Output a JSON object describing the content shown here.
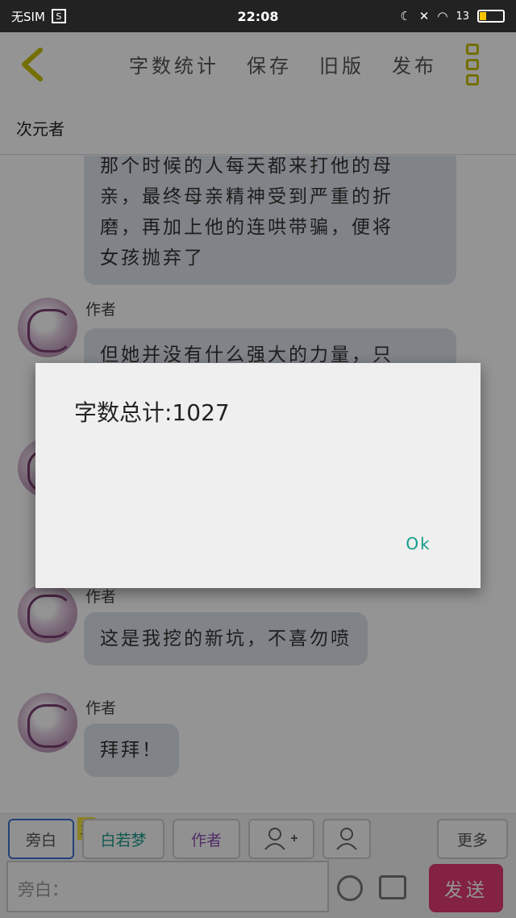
{
  "status_bar": {
    "sim_text": "无SIM",
    "time": "22:08",
    "battery": "13",
    "battery_color": "#f5c400"
  },
  "header": {
    "back_icon": "chevron-left-icon",
    "menu": [
      "字数统计",
      "保存",
      "旧版",
      "发布"
    ],
    "more_icon": "vertical-dots-icon",
    "accent_color": "#c8c000"
  },
  "chat_title": "次元者",
  "messages": [
    {
      "sender": "",
      "text_lines": [
        "那个时候的人每天都来打他的母",
        "亲，最终母亲精神受到严重的折",
        "磨，再加上他的连哄带骗，便将",
        "女孩抛弃了"
      ]
    },
    {
      "sender": "作者",
      "text_lines": [
        "但她并没有什么强大的力量，只"
      ]
    },
    {
      "sender": "作者",
      "text_lines": [
        "这是我挖的新坑，不喜勿喷"
      ]
    },
    {
      "sender": "作者",
      "text_lines": [
        "拜拜！"
      ]
    }
  ],
  "toolbar": {
    "roles": [
      "旁白",
      "白若梦",
      "作者"
    ],
    "main_tag": "主",
    "add_role_icon": "add-person-icon",
    "person_icon": "person-icon",
    "more_label": "更多",
    "input_placeholder": "旁白：",
    "emoji_icon": "smiley-icon",
    "image_icon": "image-icon",
    "send_label": "发送",
    "send_color": "#e23b73"
  },
  "dialog": {
    "message": "字数总计:1027",
    "ok_label": "Ok"
  }
}
